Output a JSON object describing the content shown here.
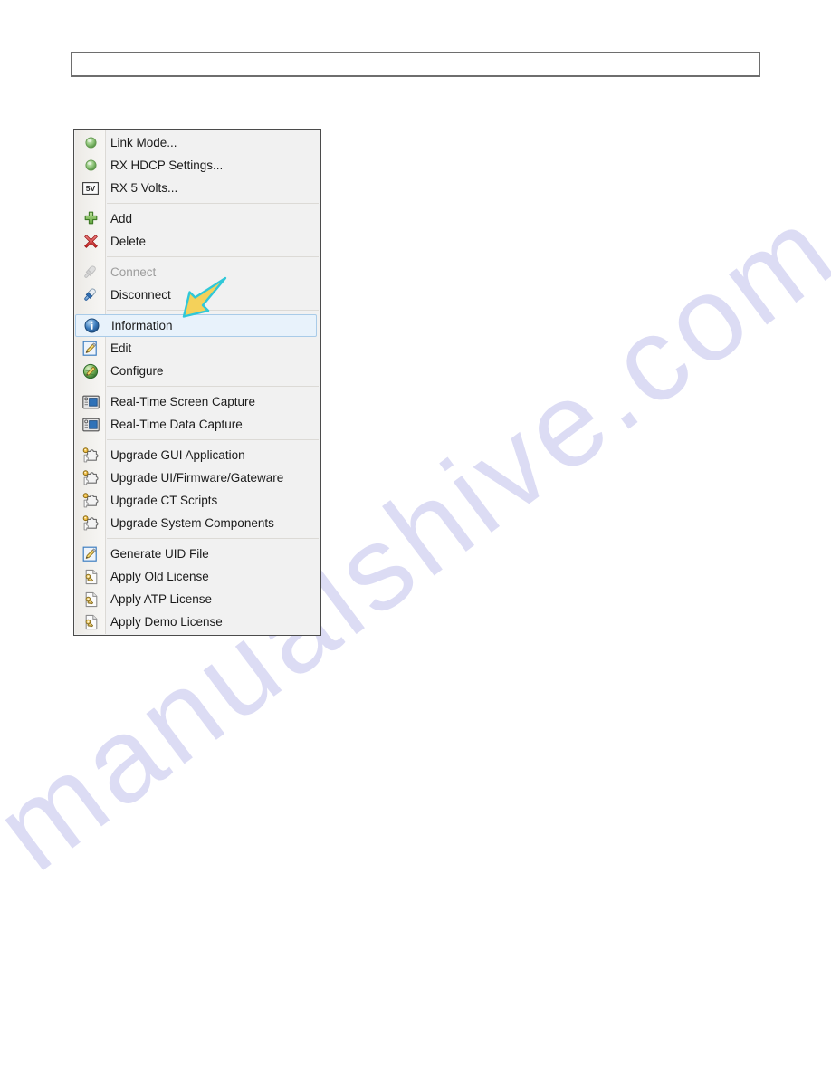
{
  "page": {
    "watermark_text": "manualshive.com",
    "background_color": "#ffffff"
  },
  "top_bar": {
    "name": "empty-text-box",
    "value": "",
    "placeholder": ""
  },
  "context_menu": {
    "title": "Device context menu",
    "background_color": "#f1f1f1",
    "border_color": "#4b4b4b",
    "selected_item": "Information",
    "selected_bg_color": "#e8f2fb",
    "selected_border_color": "#a9cbe8",
    "groups": [
      {
        "items": [
          {
            "label": "Link Mode...",
            "icon": "green-sphere-icon",
            "disabled": false
          },
          {
            "label": "RX HDCP Settings...",
            "icon": "green-sphere-icon",
            "disabled": false
          },
          {
            "label": "RX 5 Volts...",
            "icon": "five-volt-badge-icon",
            "disabled": false
          }
        ]
      },
      {
        "items": [
          {
            "label": "Add",
            "icon": "green-plus-icon",
            "disabled": false
          },
          {
            "label": "Delete",
            "icon": "red-x-icon",
            "disabled": false
          }
        ]
      },
      {
        "items": [
          {
            "label": "Connect",
            "icon": "plug-disabled-icon",
            "disabled": true
          },
          {
            "label": "Disconnect",
            "icon": "plug-blue-icon",
            "disabled": false
          }
        ]
      },
      {
        "items": [
          {
            "label": "Information",
            "icon": "info-circle-icon",
            "disabled": false,
            "selected": true
          },
          {
            "label": "Edit",
            "icon": "edit-pencil-icon",
            "disabled": false
          },
          {
            "label": "Configure",
            "icon": "globe-pencil-icon",
            "disabled": false
          }
        ]
      },
      {
        "items": [
          {
            "label": "Real-Time Screen Capture",
            "icon": "camera-monitor-icon",
            "disabled": false
          },
          {
            "label": "Real-Time Data Capture",
            "icon": "camera-monitor-icon",
            "disabled": false
          }
        ]
      },
      {
        "items": [
          {
            "label": "Upgrade GUI Application",
            "icon": "puzzle-piece-icon",
            "disabled": false
          },
          {
            "label": "Upgrade UI/Firmware/Gateware",
            "icon": "puzzle-piece-icon",
            "disabled": false
          },
          {
            "label": "Upgrade CT Scripts",
            "icon": "puzzle-piece-icon",
            "disabled": false
          },
          {
            "label": "Upgrade System Components",
            "icon": "puzzle-piece-icon",
            "disabled": false
          }
        ]
      },
      {
        "items": [
          {
            "label": "Generate UID File",
            "icon": "edit-pencil-icon",
            "disabled": false
          },
          {
            "label": "Apply Old License",
            "icon": "key-document-icon",
            "disabled": false
          },
          {
            "label": "Apply ATP License",
            "icon": "key-document-icon",
            "disabled": false
          },
          {
            "label": "Apply Demo License",
            "icon": "key-document-icon",
            "disabled": false
          }
        ]
      }
    ]
  },
  "cursor": {
    "name": "yellow-arrow-pointer",
    "fill_color": "#f4d15a",
    "outline_color": "#2fc8d8",
    "direction": "down-left"
  }
}
